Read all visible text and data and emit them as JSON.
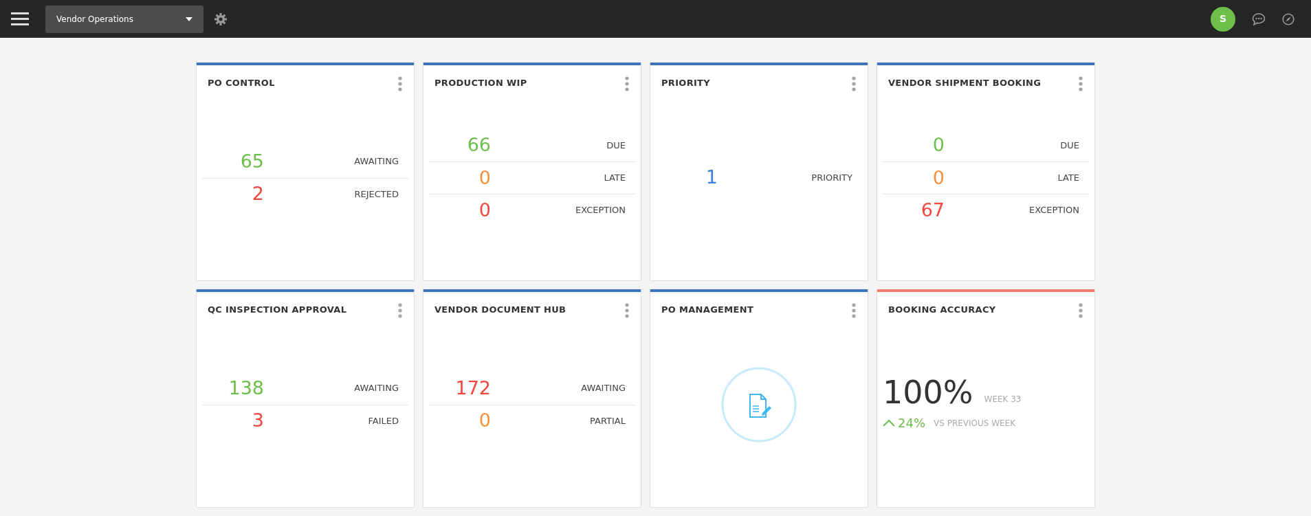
{
  "top_bar": {
    "workspace": "Vendor Operations",
    "avatar_initial": "S"
  },
  "widgets": [
    {
      "kind": "metrics",
      "title": "PO CONTROL",
      "color": "#3d74c0",
      "metrics": [
        {
          "value": "65",
          "label": "AWAITING",
          "color": "#6cbf4a"
        },
        {
          "value": "2",
          "label": "REJECTED",
          "color": "#f2483f"
        }
      ]
    },
    {
      "kind": "metrics",
      "title": "PRODUCTION WIP",
      "color": "#3d74c0",
      "metrics": [
        {
          "value": "66",
          "label": "DUE",
          "color": "#6cbf4a"
        },
        {
          "value": "0",
          "label": "LATE",
          "color": "#f7903a"
        },
        {
          "value": "0",
          "label": "EXCEPTION",
          "color": "#f2483f"
        }
      ]
    },
    {
      "kind": "metrics",
      "title": "PRIORITY",
      "color": "#3d74c0",
      "metrics": [
        {
          "value": "1",
          "label": "PRIORITY",
          "color": "#3a7fd5"
        }
      ]
    },
    {
      "kind": "metrics",
      "title": "VENDOR SHIPMENT BOOKING",
      "color": "#3d74c0",
      "metrics": [
        {
          "value": "0",
          "label": "DUE",
          "color": "#6cbf4a"
        },
        {
          "value": "0",
          "label": "LATE",
          "color": "#f7903a"
        },
        {
          "value": "67",
          "label": "EXCEPTION",
          "color": "#f2483f"
        }
      ]
    },
    {
      "kind": "metrics",
      "title": "QC INSPECTION APPROVAL",
      "color": "#3d74c0",
      "metrics": [
        {
          "value": "138",
          "label": "AWAITING",
          "color": "#6cbf4a"
        },
        {
          "value": "3",
          "label": "FAILED",
          "color": "#f2483f"
        }
      ]
    },
    {
      "kind": "metrics",
      "title": "VENDOR DOCUMENT HUB",
      "color": "#3d74c0",
      "metrics": [
        {
          "value": "172",
          "label": "AWAITING",
          "color": "#f2483f"
        },
        {
          "value": "0",
          "label": "PARTIAL",
          "color": "#f7903a"
        }
      ]
    },
    {
      "kind": "icon",
      "title": "PO MANAGEMENT",
      "color": "#3d74c0"
    },
    {
      "kind": "accuracy",
      "title": "BOOKING ACCURACY",
      "color": "#f47c6c",
      "value": "100%",
      "period": "WEEK 33",
      "change": "24%",
      "comparison": "VS PREVIOUS WEEK"
    }
  ]
}
